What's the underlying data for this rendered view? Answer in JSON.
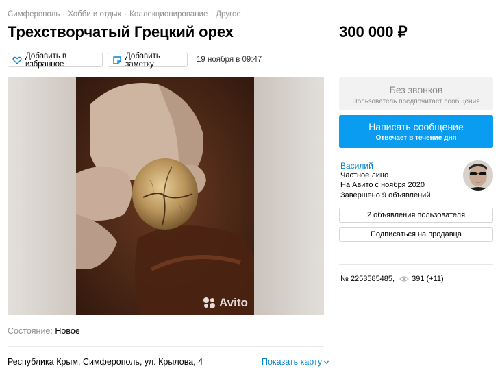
{
  "breadcrumbs": [
    "Симферополь",
    "Хобби и отдых",
    "Коллекционирование",
    "Другое"
  ],
  "title": "Трехстворчатый Грецкий орех",
  "price": "300 000 ₽",
  "actions": {
    "favorite": "Добавить в избранное",
    "note": "Добавить заметку",
    "date": "19 ноября в 09:47"
  },
  "gallery": {
    "watermark": "Avito"
  },
  "details": {
    "condition_label": "Состояние:",
    "condition_value": "Новое",
    "address": "Республика Крым, Симферополь, ул. Крылова, 4",
    "map_link": "Показать карту"
  },
  "contact": {
    "no_calls_title": "Без звонков",
    "no_calls_sub": "Пользователь предпочитает сообщения",
    "message_title": "Написать сообщение",
    "message_sub": "Отвечает в течение дня"
  },
  "seller": {
    "name": "Василий",
    "type": "Частное лицо",
    "since": "На Авито с ноября 2020",
    "completed": "Завершено 9 объявлений",
    "ads_button": "2 объявления пользователя",
    "subscribe_button": "Подписаться на продавца"
  },
  "meta": {
    "ad_number": "№ 2253585485,",
    "views": "391 (+11)"
  },
  "colors": {
    "accent": "#0a9cf0",
    "link": "#0a84ce",
    "muted": "#8f8f8f"
  }
}
